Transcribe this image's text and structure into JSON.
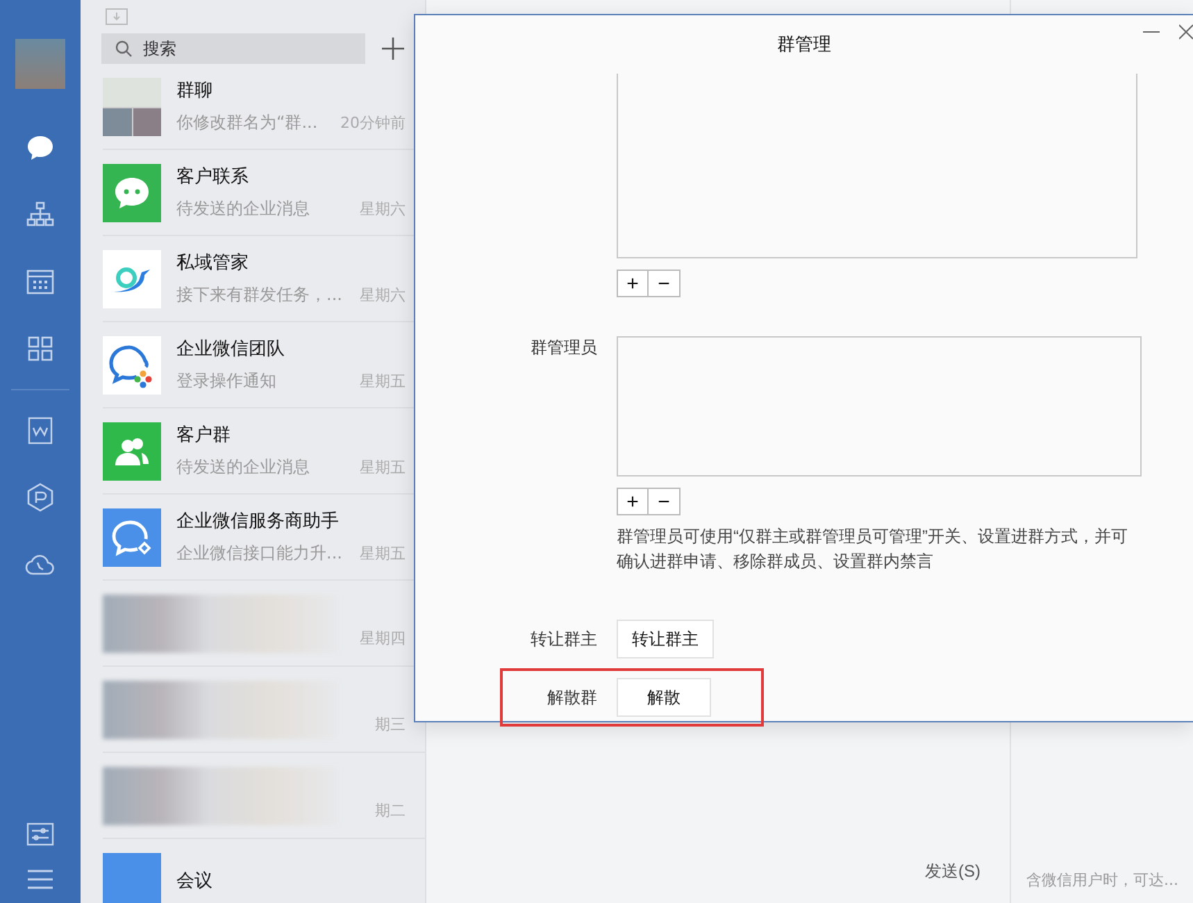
{
  "nav": [
    {
      "selected": true
    },
    {
      "selected": false
    },
    {
      "selected": false
    },
    {
      "selected": false
    },
    {
      "selected": false
    },
    {
      "selected": false
    },
    {
      "selected": false
    }
  ],
  "search": {
    "placeholder": "搜索"
  },
  "chats": [
    {
      "kind": "chat",
      "name": "群聊",
      "preview": "你修改群名为“群...",
      "time": "20分钟前"
    },
    {
      "kind": "chat",
      "name": "客户联系",
      "preview": "待发送的企业消息",
      "time": "星期六"
    },
    {
      "kind": "chat",
      "name": "私域管家",
      "preview": "接下来有群发任务，...",
      "time": "星期六"
    },
    {
      "kind": "chat",
      "name": "企业微信团队",
      "preview": "登录操作通知",
      "time": "星期五"
    },
    {
      "kind": "chat",
      "name": "客户群",
      "preview": "待发送的企业消息",
      "time": "星期五"
    },
    {
      "kind": "chat",
      "name": "企业微信服务商助手",
      "preview": "企业微信接口能力升...",
      "time": "星期五"
    },
    {
      "kind": "blurred",
      "time": "星期四"
    },
    {
      "kind": "blurred",
      "time": "期三"
    },
    {
      "kind": "blurred",
      "time": "期二"
    },
    {
      "kind": "chat",
      "name": "会议"
    }
  ],
  "main": {
    "send_button": "发送(S)",
    "side_note": "含微信用户时，可达..."
  },
  "dialog": {
    "title": "群管理",
    "fields": [
      {
        "kind": "list"
      },
      {
        "kind": "list",
        "label": "群管理员",
        "note": "群管理员可使用“仅群主或群管理员可管理”开关、设置进群方式，并可确认进群申请、移除群成员、设置群内禁言"
      },
      {
        "kind": "button",
        "label": "转让群主",
        "button": "转让群主",
        "highlighted": false
      },
      {
        "kind": "button",
        "label": "解散群",
        "button": "解散",
        "highlighted": true
      }
    ],
    "add_button": "+",
    "remove_button": "−"
  }
}
